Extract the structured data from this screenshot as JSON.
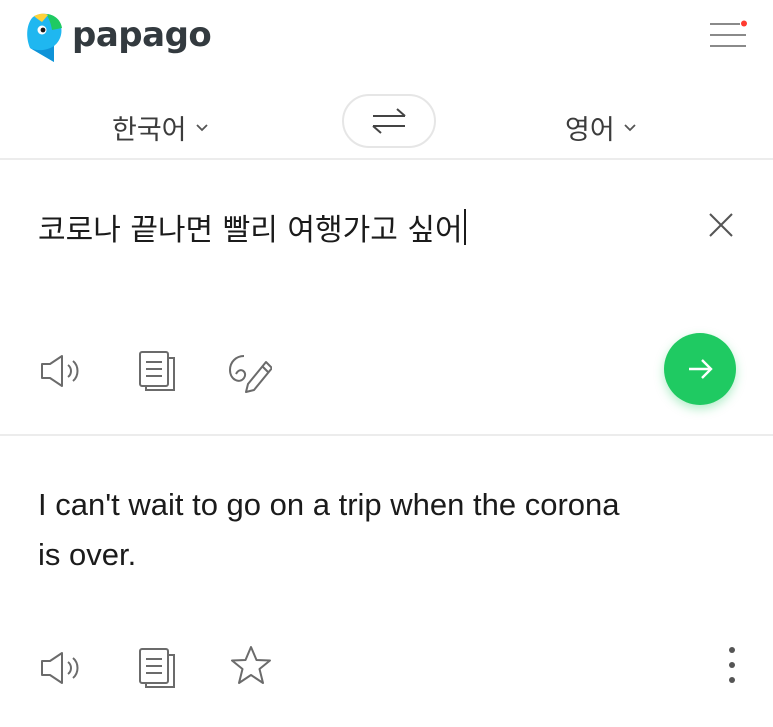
{
  "app": {
    "brand_name": "papago"
  },
  "language_bar": {
    "source_language": "한국어",
    "target_language": "영어"
  },
  "input": {
    "text": "코로나 끝나면 빨리 여행가고 싶어"
  },
  "output": {
    "text": "I can't wait to go on a trip when the corona is over."
  },
  "icons": {
    "logo": "papago-parrot-logo",
    "menu": "hamburger-menu-icon",
    "notification_dot_color": "#ff3b30",
    "swap": "swap-arrows-icon",
    "clear": "close-icon",
    "speaker": "speaker-icon",
    "copy": "copy-icon",
    "handwriting": "handwriting-pen-icon",
    "translate": "arrow-right-icon",
    "favorite": "star-icon",
    "more": "more-vertical-icon"
  },
  "colors": {
    "accent_green": "#1fca62",
    "text": "#1b1b1b",
    "icon_gray": "#6b6b6b"
  }
}
